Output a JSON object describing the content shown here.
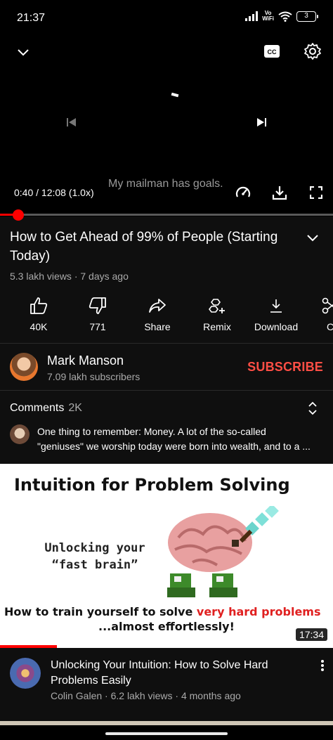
{
  "status_bar": {
    "time": "21:37",
    "network_label": "Vo\nWiFi",
    "battery": "3"
  },
  "player": {
    "caption": "My mailman has goals.",
    "time_display": "0:40 / 12:08 (1.0x)",
    "progress_fraction": 0.055,
    "cc_label": "CC",
    "icons": [
      "chevron-down-icon",
      "cc-icon",
      "settings-gear-icon",
      "previous-icon",
      "next-icon",
      "speed-icon",
      "download-icon",
      "fullscreen-icon"
    ],
    "accent_color": "#ff0000"
  },
  "video": {
    "title": "How to Get Ahead of 99% of People (Starting Today)",
    "views_line": "5.3 lakh views · 7 days ago"
  },
  "actions": [
    {
      "label": "40K",
      "icon": "thumbs-up-icon"
    },
    {
      "label": "771",
      "icon": "thumbs-down-icon"
    },
    {
      "label": "Share",
      "icon": "share-icon"
    },
    {
      "label": "Remix",
      "icon": "remix-icon"
    },
    {
      "label": "Download",
      "icon": "download-icon"
    },
    {
      "label": "C",
      "icon": "clip-icon"
    }
  ],
  "channel": {
    "name": "Mark Manson",
    "subscribers": "7.09 lakh subscribers",
    "subscribe_label": "SUBSCRIBE",
    "subscribe_color": "#ff4e45"
  },
  "comments": {
    "heading": "Comments",
    "count": "2K",
    "top_comment_line1": "One thing to remember:  Money.  A lot of the so-called",
    "top_comment_line2": "\"geniuses\" we worship today were born into wealth, and to a ..."
  },
  "recommended": {
    "thumbnail": {
      "headline": "Intuition for Problem Solving",
      "sub_line1": "Unlocking your",
      "sub_line2": "“fast brain”",
      "bottom_line_a": "How to train yourself to solve ",
      "bottom_line_highlight": "very hard problems",
      "bottom_line_b": "...almost effortlessly!",
      "duration": "17:34",
      "watched_fraction": 0.17
    },
    "title": "Unlocking Your Intuition: How to Solve Hard Problems Easily",
    "meta": "Colin Galen · 6.2 lakh views · 4 months ago"
  }
}
